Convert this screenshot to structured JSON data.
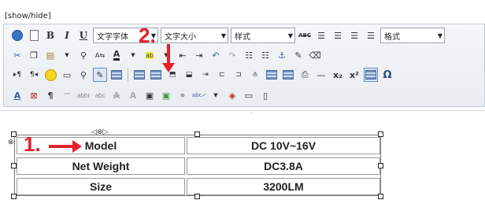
{
  "editor": {
    "show_hide_label": "[show/hide]"
  },
  "toolbar": {
    "row1": {
      "font_family": {
        "value": "文字字体"
      },
      "font_size": {
        "value": "文字大小"
      },
      "style": {
        "value": "样式"
      },
      "abc_label": "ABC",
      "format": {
        "value": "格式"
      }
    },
    "row3": {
      "subscript_label": "x₂",
      "superscript_label": "x²",
      "special_char_label": "Ω"
    },
    "row4": {
      "pilcrow_label": "¶"
    }
  },
  "table": {
    "rows": [
      {
        "label": "Model",
        "value": "DC 10V~16V"
      },
      {
        "label": "Net Weight",
        "value": "DC3.8A"
      },
      {
        "label": "Size",
        "value": "3200LM"
      }
    ]
  },
  "annotations": {
    "step1": "1.",
    "step2": "2.",
    "color": "#e4202a"
  }
}
